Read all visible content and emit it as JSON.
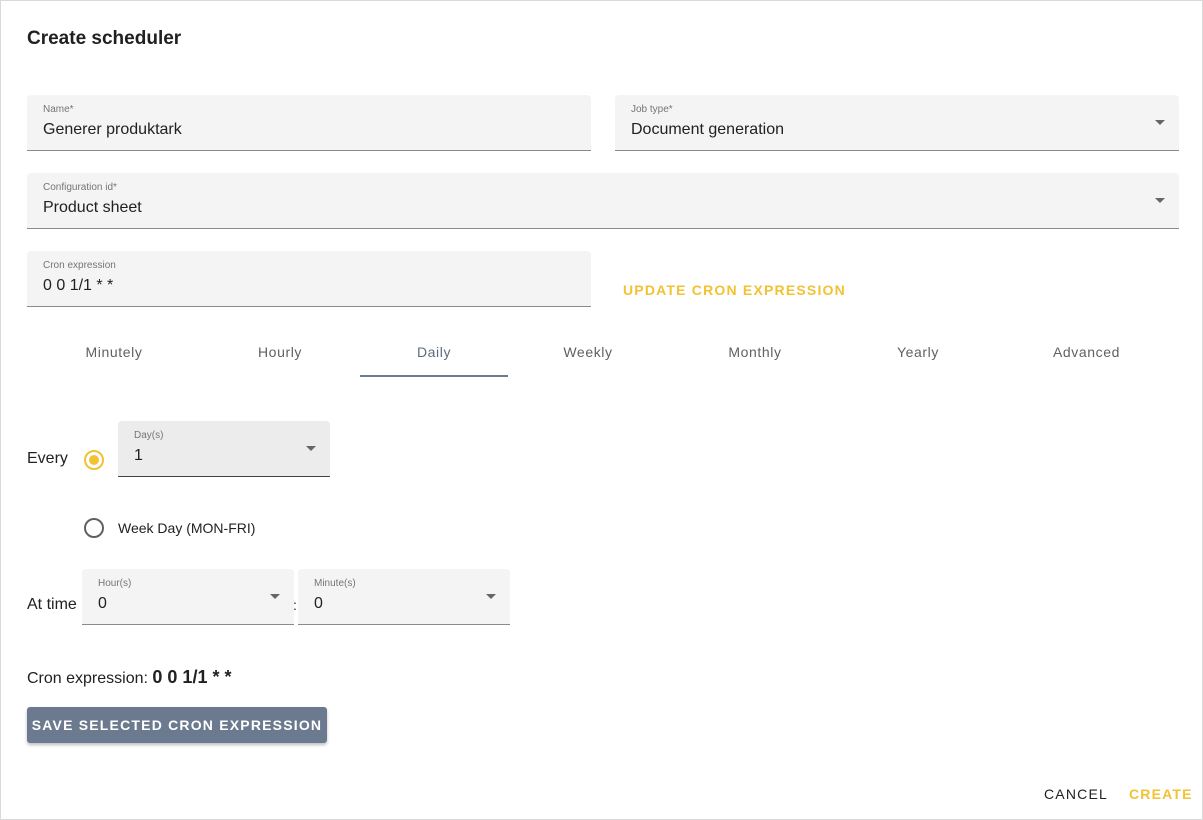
{
  "dialog": {
    "title": "Create scheduler"
  },
  "form": {
    "name": {
      "label": "Name*",
      "value": "Generer produktark"
    },
    "job_type": {
      "label": "Job type*",
      "value": "Document generation"
    },
    "configuration_id": {
      "label": "Configuration id*",
      "value": "Product sheet"
    },
    "cron_expression": {
      "label": "Cron expression",
      "value": "0 0 1/1 * *"
    },
    "update_cron_label": "UPDATE CRON EXPRESSION"
  },
  "tabs": [
    "Minutely",
    "Hourly",
    "Daily",
    "Weekly",
    "Monthly",
    "Yearly",
    "Advanced"
  ],
  "active_tab": "Daily",
  "daily": {
    "every_label": "Every",
    "days": {
      "label": "Day(s)",
      "value": "1"
    },
    "weekday_label": "Week Day (MON-FRI)",
    "selected_option": "every",
    "at_time_label": "At time",
    "hours": {
      "label": "Hour(s)",
      "value": "0"
    },
    "time_separator": ":",
    "minutes": {
      "label": "Minute(s)",
      "value": "0"
    }
  },
  "cron_result": {
    "label": "Cron expression:",
    "value": "0 0 1/1 * *"
  },
  "save_label": "SAVE SELECTED CRON EXPRESSION",
  "footer": {
    "cancel_label": "CANCEL",
    "create_label": "CREATE"
  },
  "colors": {
    "accent": "#f2c235",
    "primary": "#6b7a8f",
    "field_bg": "#f4f4f4"
  },
  "icons": {
    "dropdown": "caret-down-icon"
  }
}
